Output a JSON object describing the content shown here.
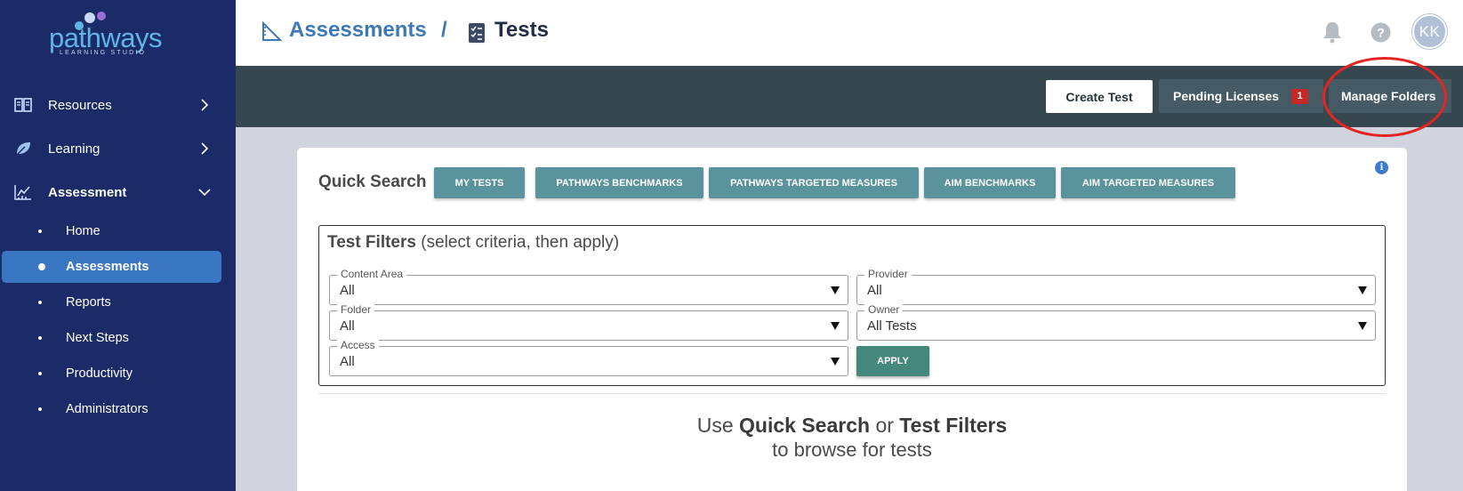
{
  "sidebar": {
    "logo_text": "pathways",
    "logo_subtext": "LEARNING STUDIO",
    "nav": [
      {
        "label": "Resources",
        "expanded": false
      },
      {
        "label": "Learning",
        "expanded": false
      },
      {
        "label": "Assessment",
        "expanded": true
      }
    ],
    "subitems": [
      {
        "label": "Home",
        "active": false
      },
      {
        "label": "Assessments",
        "active": true
      },
      {
        "label": "Reports",
        "active": false
      },
      {
        "label": "Next Steps",
        "active": false
      },
      {
        "label": "Productivity",
        "active": false
      },
      {
        "label": "Administrators",
        "active": false
      }
    ]
  },
  "header": {
    "breadcrumb_parent": "Assessments",
    "breadcrumb_separator": "/",
    "breadcrumb_current": "Tests",
    "avatar_initials": "KK"
  },
  "toolbar": {
    "create_label": "Create Test",
    "pending_label": "Pending Licenses",
    "pending_count": "1",
    "manage_label": "Manage Folders"
  },
  "quick_search": {
    "label": "Quick Search",
    "buttons": [
      "MY TESTS",
      "PATHWAYS BENCHMARKS",
      "PATHWAYS TARGETED MEASURES",
      "AIM BENCHMARKS",
      "AIM TARGETED MEASURES"
    ]
  },
  "filters": {
    "title": "Test Filters",
    "subtitle": "(select criteria, then apply)",
    "content_area": {
      "label": "Content Area",
      "value": "All"
    },
    "provider": {
      "label": "Provider",
      "value": "All"
    },
    "folder": {
      "label": "Folder",
      "value": "All"
    },
    "owner": {
      "label": "Owner",
      "value": "All Tests"
    },
    "access": {
      "label": "Access",
      "value": "All"
    },
    "apply_label": "APPLY"
  },
  "hint": {
    "use": "Use",
    "quick_search": "Quick Search",
    "or": "or",
    "test_filters": "Test Filters",
    "line2": "to browse for tests"
  },
  "colors": {
    "sidebar_bg": "#1a2b68",
    "active_item": "#3a77c3",
    "toolbar_bg": "#37474f",
    "quick_btn": "#5a939c",
    "apply_btn": "#45877a",
    "highlight_ring": "#e52522"
  }
}
